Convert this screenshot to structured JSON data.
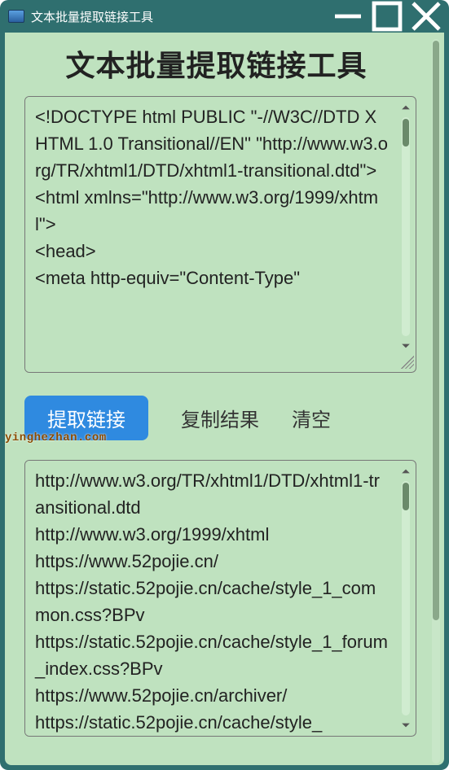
{
  "window": {
    "title": "文本批量提取链接工具"
  },
  "page": {
    "heading": "文本批量提取链接工具"
  },
  "input": {
    "text": "<!DOCTYPE html PUBLIC \"-//W3C//DTD XHTML 1.0 Transitional//EN\" \"http://www.w3.org/TR/xhtml1/DTD/xhtml1-transitional.dtd\">\n<html xmlns=\"http://www.w3.org/1999/xhtml\">\n<head>\n<meta http-equiv=\"Content-Type\""
  },
  "buttons": {
    "extract": "提取链接",
    "copy": "复制结果",
    "clear": "清空"
  },
  "output": {
    "text": "http://www.w3.org/TR/xhtml1/DTD/xhtml1-transitional.dtd\nhttp://www.w3.org/1999/xhtml\nhttps://www.52pojie.cn/\nhttps://static.52pojie.cn/cache/style_1_common.css?BPv\nhttps://static.52pojie.cn/cache/style_1_forum_index.css?BPv\nhttps://www.52pojie.cn/archiver/\nhttps://static.52pojie.cn/cache/style_"
  },
  "watermark": "yinghezhan.com"
}
